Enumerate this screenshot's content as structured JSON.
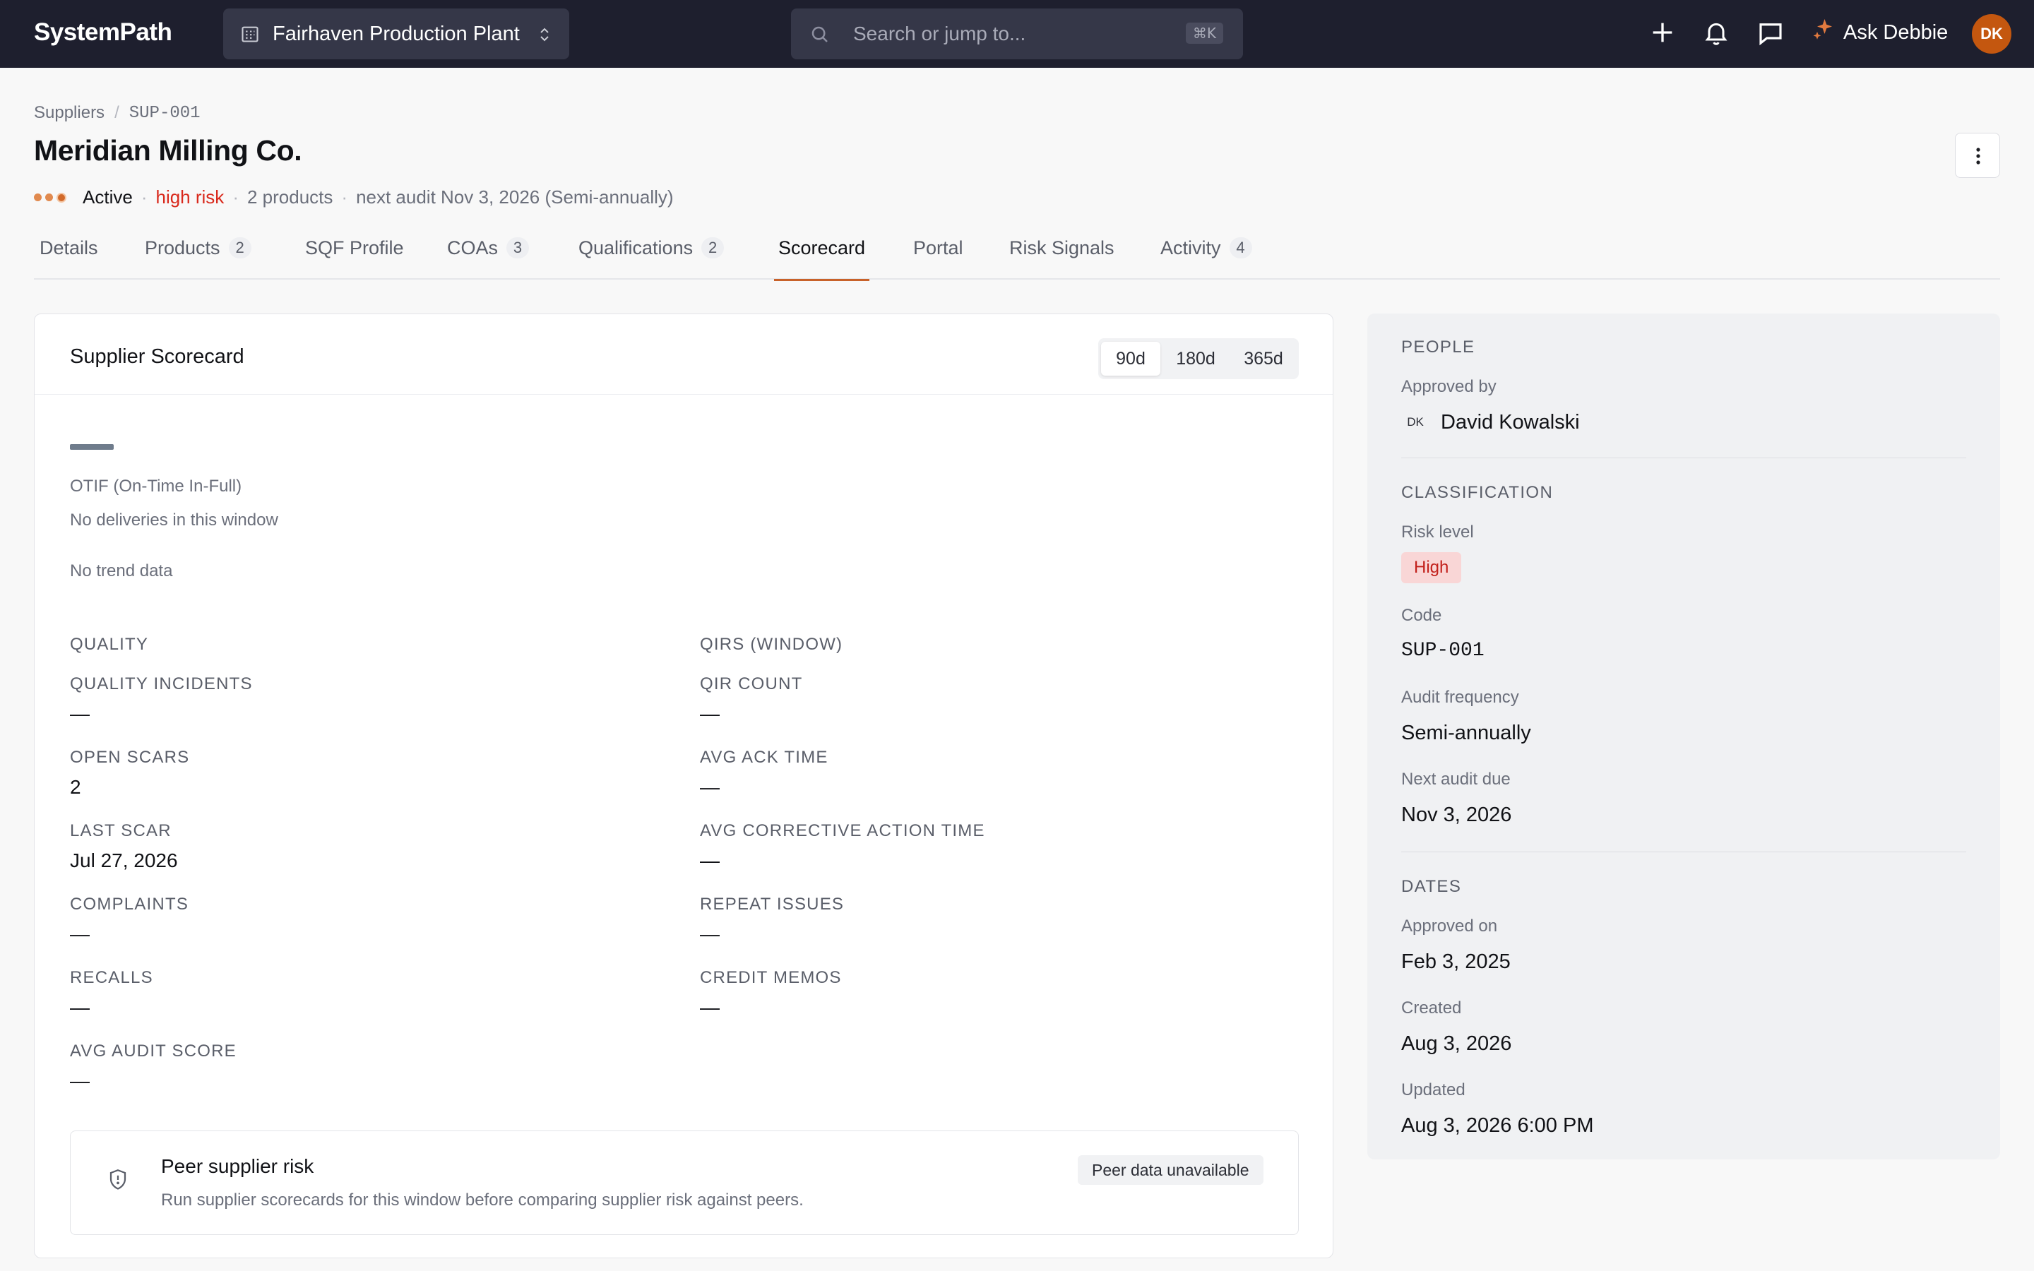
{
  "app": {
    "brand": "SystemPath",
    "site": "Fairhaven Production Plant",
    "search_placeholder": "Search or jump to...",
    "search_shortcut": "⌘K",
    "ask_label": "Ask Debbie",
    "user_initials": "DK",
    "icons": [
      "building-icon",
      "chevron-updown-icon",
      "search-icon",
      "plus-icon",
      "bell-icon",
      "chat-icon",
      "sparkle-icon",
      "more-vertical-icon",
      "shield-icon"
    ]
  },
  "breadcrumb": {
    "parent": "Suppliers",
    "current": "SUP-001"
  },
  "supplier": {
    "name": "Meridian Milling Co.",
    "status": "Active",
    "risk": "high risk",
    "products": "2 products",
    "next_audit": "next audit Nov 3, 2026 (Semi-annually)"
  },
  "tabs": [
    {
      "label": "Details",
      "count": ""
    },
    {
      "label": "Products",
      "count": "2"
    },
    {
      "label": "SQF Profile",
      "count": ""
    },
    {
      "label": "COAs",
      "count": "3"
    },
    {
      "label": "Qualifications",
      "count": "2"
    },
    {
      "label": "Scorecard",
      "count": "",
      "active": true
    },
    {
      "label": "Portal",
      "count": ""
    },
    {
      "label": "Risk Signals",
      "count": ""
    },
    {
      "label": "Activity",
      "count": "4"
    }
  ],
  "scorecard": {
    "title": "Supplier Scorecard",
    "windows": [
      "90d",
      "180d",
      "365d"
    ],
    "selected_window": "90d",
    "otif_label": "OTIF (On-Time In-Full)",
    "otif_sub": "No deliveries in this window",
    "trend": "No trend data",
    "quality_heading": "QUALITY",
    "qirs_heading": "QIRS (WINDOW)",
    "quality_metrics": [
      {
        "label": "QUALITY INCIDENTS",
        "value": "—"
      },
      {
        "label": "OPEN SCARS",
        "value": "2"
      },
      {
        "label": "LAST SCAR",
        "value": "Jul 27, 2026"
      },
      {
        "label": "COMPLAINTS",
        "value": "—"
      },
      {
        "label": "RECALLS",
        "value": "—"
      },
      {
        "label": "AVG AUDIT SCORE",
        "value": "—"
      }
    ],
    "qir_metrics": [
      {
        "label": "QIR COUNT",
        "value": "—"
      },
      {
        "label": "AVG ACK TIME",
        "value": "—"
      },
      {
        "label": "AVG CORRECTIVE ACTION TIME",
        "value": "—"
      },
      {
        "label": "REPEAT ISSUES",
        "value": "—"
      },
      {
        "label": "CREDIT MEMOS",
        "value": "—"
      }
    ],
    "peer": {
      "title": "Peer supplier risk",
      "description": "Run supplier scorecards for this window before comparing supplier risk against peers.",
      "badge": "Peer data unavailable"
    }
  },
  "side": {
    "people_heading": "PEOPLE",
    "approved_by_label": "Approved by",
    "approver_initials": "DK",
    "approver_name": "David Kowalski",
    "classification_heading": "CLASSIFICATION",
    "risk_level_label": "Risk level",
    "risk_level": "High",
    "code_label": "Code",
    "code": "SUP-001",
    "audit_frequency_label": "Audit frequency",
    "audit_frequency": "Semi-annually",
    "next_audit_label": "Next audit due",
    "next_audit": "Nov 3, 2026",
    "dates_heading": "DATES",
    "approved_on_label": "Approved on",
    "approved_on": "Feb 3, 2025",
    "created_label": "Created",
    "created": "Aug 3, 2026",
    "updated_label": "Updated",
    "updated": "Aug 3, 2026 6:00 PM"
  },
  "colors": {
    "topbar": "#1e1f2e",
    "accent": "#c8622a",
    "risk": "#d9291c",
    "risk_pill_bg": "#f9d6d6"
  }
}
